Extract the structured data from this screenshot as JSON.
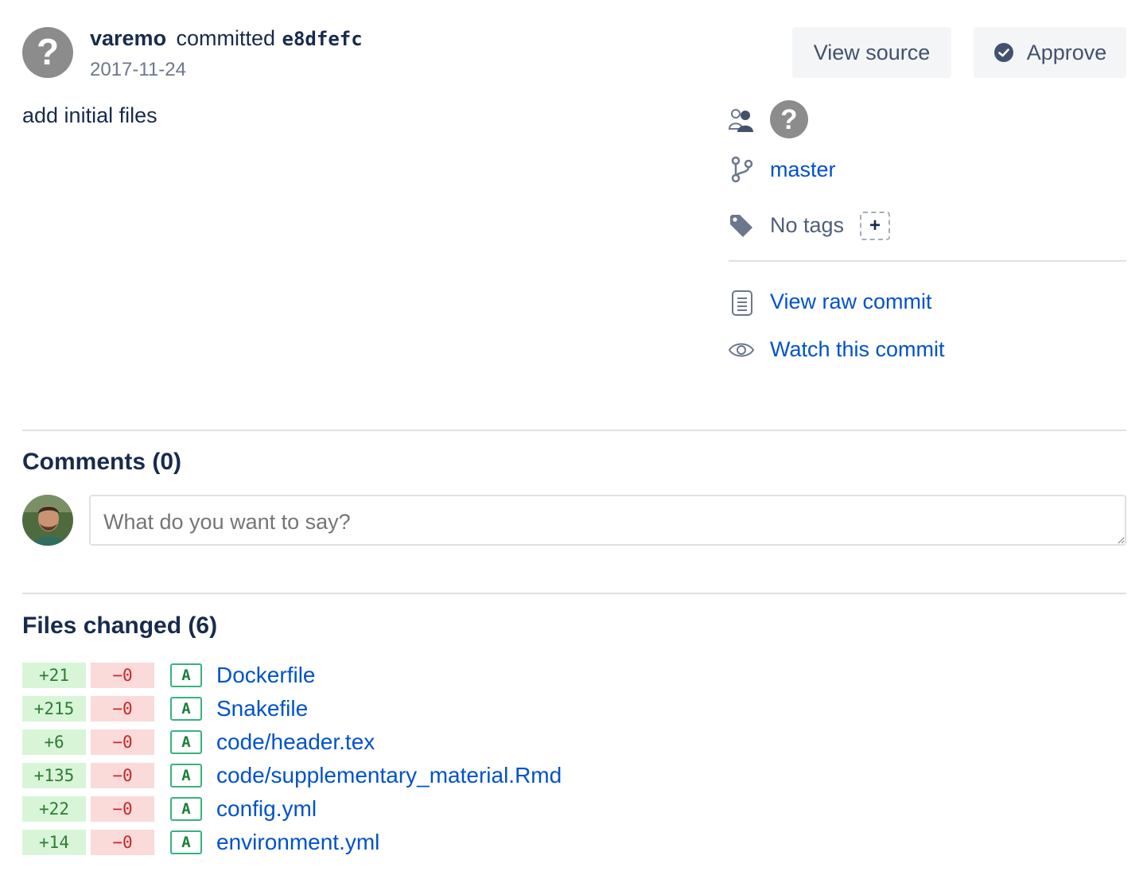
{
  "commit": {
    "author": "varemo",
    "action": "committed",
    "hash": "e8dfefc",
    "date": "2017-11-24",
    "message": "add initial files"
  },
  "actions": {
    "view_source": "View source",
    "approve": "Approve"
  },
  "sidebar": {
    "branch": "master",
    "tags_label": "No tags",
    "tag_add": "+",
    "view_raw": "View raw commit",
    "watch": "Watch this commit"
  },
  "comments": {
    "title": "Comments (0)",
    "placeholder": "What do you want to say?"
  },
  "files": {
    "title": "Files changed (6)",
    "items": [
      {
        "added": "+21",
        "removed": "−0",
        "status": "A",
        "name": "Dockerfile"
      },
      {
        "added": "+215",
        "removed": "−0",
        "status": "A",
        "name": "Snakefile"
      },
      {
        "added": "+6",
        "removed": "−0",
        "status": "A",
        "name": "code/header.tex"
      },
      {
        "added": "+135",
        "removed": "−0",
        "status": "A",
        "name": "code/supplementary_material.Rmd"
      },
      {
        "added": "+22",
        "removed": "−0",
        "status": "A",
        "name": "config.yml"
      },
      {
        "added": "+14",
        "removed": "−0",
        "status": "A",
        "name": "environment.yml"
      }
    ]
  },
  "colors": {
    "link": "#0052cc",
    "added_bg": "#d8f5d8",
    "removed_bg": "#fbdada",
    "status_border": "#36b37e"
  }
}
